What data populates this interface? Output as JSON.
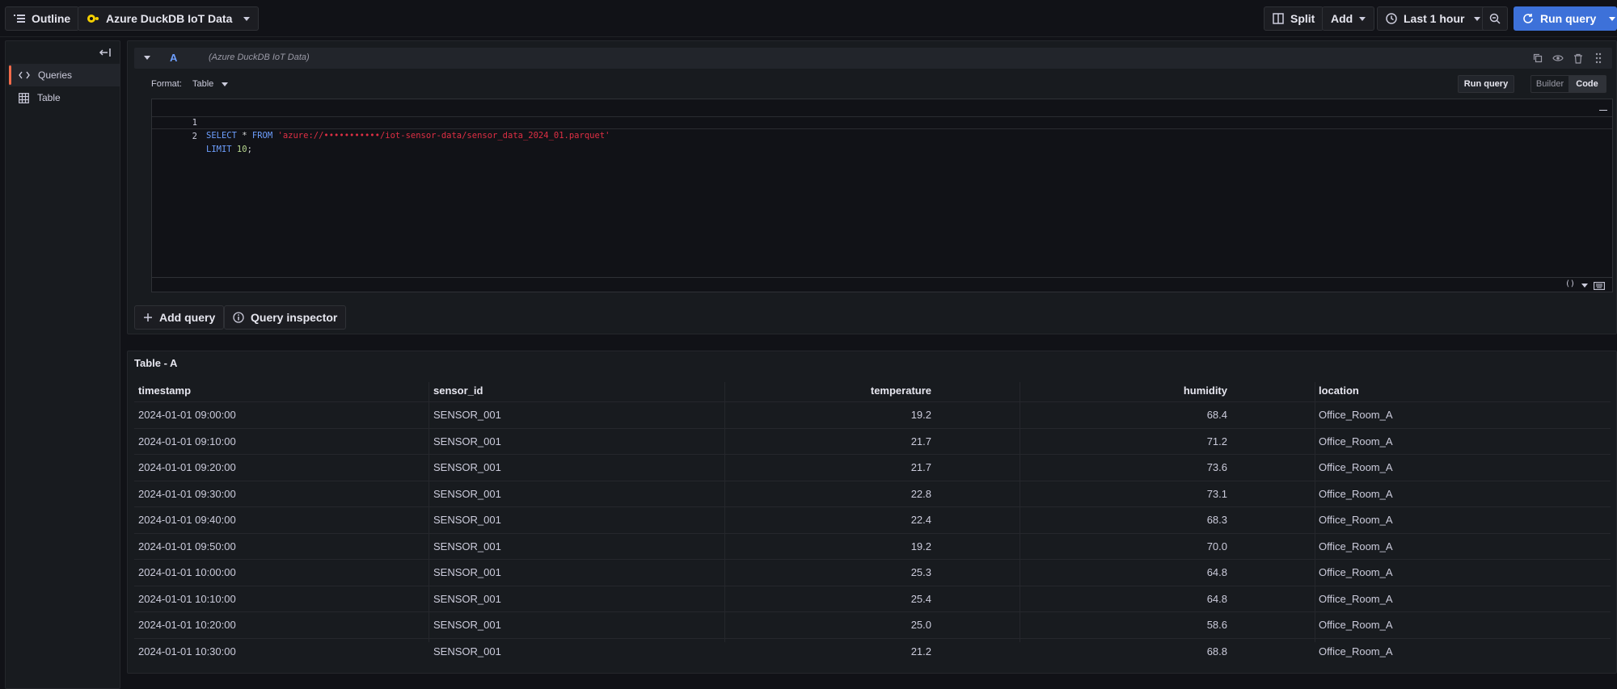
{
  "topbar": {
    "outline_label": "Outline",
    "datasource_name": "Azure DuckDB IoT Data",
    "split_label": "Split",
    "add_label": "Add",
    "time_range": "Last 1 hour",
    "run_query_label": "Run query"
  },
  "sidebar": {
    "items": [
      {
        "label": "Queries"
      },
      {
        "label": "Table"
      }
    ]
  },
  "query": {
    "ref_id": "A",
    "datasource": "(Azure DuckDB IoT Data)",
    "format_label": "Format:",
    "format_value": "Table",
    "run_label": "Run query",
    "modes": [
      "Builder",
      "Code"
    ],
    "active_mode": "Code",
    "lines": [
      {
        "n": "1",
        "kw1": "SELECT",
        "star": " * ",
        "kw2": "FROM",
        "str": " 'azure://•••••••••••/iot-sensor-data/sensor_data_2024_01.parquet'"
      },
      {
        "n": "2",
        "kw1": "LIMIT",
        "num": " 10",
        "end": ";"
      }
    ],
    "add_query_label": "Add query",
    "inspector_label": "Query inspector"
  },
  "table": {
    "title": "Table - A",
    "columns": [
      "timestamp",
      "sensor_id",
      "temperature",
      "humidity",
      "location"
    ],
    "rows": [
      [
        "2024-01-01 09:00:00",
        "SENSOR_001",
        "19.2",
        "68.4",
        "Office_Room_A"
      ],
      [
        "2024-01-01 09:10:00",
        "SENSOR_001",
        "21.7",
        "71.2",
        "Office_Room_A"
      ],
      [
        "2024-01-01 09:20:00",
        "SENSOR_001",
        "21.7",
        "73.6",
        "Office_Room_A"
      ],
      [
        "2024-01-01 09:30:00",
        "SENSOR_001",
        "22.8",
        "73.1",
        "Office_Room_A"
      ],
      [
        "2024-01-01 09:40:00",
        "SENSOR_001",
        "22.4",
        "68.3",
        "Office_Room_A"
      ],
      [
        "2024-01-01 09:50:00",
        "SENSOR_001",
        "19.2",
        "70.0",
        "Office_Room_A"
      ],
      [
        "2024-01-01 10:00:00",
        "SENSOR_001",
        "25.3",
        "64.8",
        "Office_Room_A"
      ],
      [
        "2024-01-01 10:10:00",
        "SENSOR_001",
        "25.4",
        "64.8",
        "Office_Room_A"
      ],
      [
        "2024-01-01 10:20:00",
        "SENSOR_001",
        "25.0",
        "58.6",
        "Office_Room_A"
      ],
      [
        "2024-01-01 10:30:00",
        "SENSOR_001",
        "21.2",
        "68.8",
        "Office_Room_A"
      ]
    ]
  },
  "colors": {
    "accent": "#3d71d9",
    "active_marker": "#f36b4a",
    "datasource_dot": "#f5d000",
    "string": "#e02f44",
    "keyword": "#6e9fff"
  },
  "icons": [
    "outline-icon",
    "duckdb-icon",
    "split-icon",
    "clock-icon",
    "zoom-out-icon",
    "refresh-icon",
    "collapse-icon",
    "code-icon",
    "table-icon",
    "copy-icon",
    "eye-icon",
    "trash-icon",
    "drag-icon",
    "plus-icon",
    "info-icon",
    "keyboard-icon"
  ]
}
